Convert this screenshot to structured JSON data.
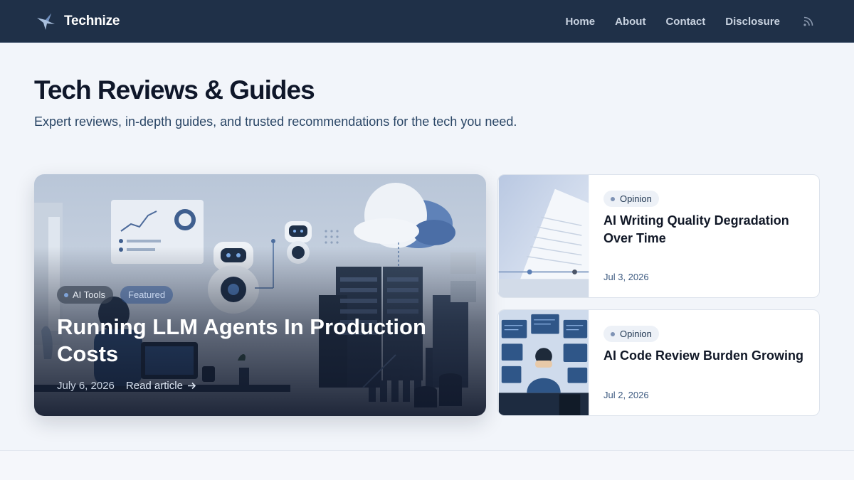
{
  "header": {
    "brand": "Technize",
    "nav": [
      "Home",
      "About",
      "Contact",
      "Disclosure"
    ],
    "icons": {
      "logo": "bird-logo-icon",
      "rss": "rss-icon"
    }
  },
  "hero": {
    "title": "Tech Reviews & Guides",
    "subtitle": "Expert reviews, in-depth guides, and trusted recommendations for the tech you need."
  },
  "featured": {
    "tags": [
      "AI Tools",
      "Featured"
    ],
    "title": "Running LLM Agents In Production Costs",
    "date": "July 6, 2026",
    "read_label": "Read article"
  },
  "side_articles": [
    {
      "category": "Opinion",
      "title": "AI Writing Quality Degradation Over Time",
      "date": "Jul 3, 2026"
    },
    {
      "category": "Opinion",
      "title": "AI Code Review Burden Growing",
      "date": "Jul 2, 2026"
    }
  ],
  "colors": {
    "header_bg": "#1f3048",
    "page_bg": "#f2f5fa",
    "accent": "#2a4666"
  }
}
